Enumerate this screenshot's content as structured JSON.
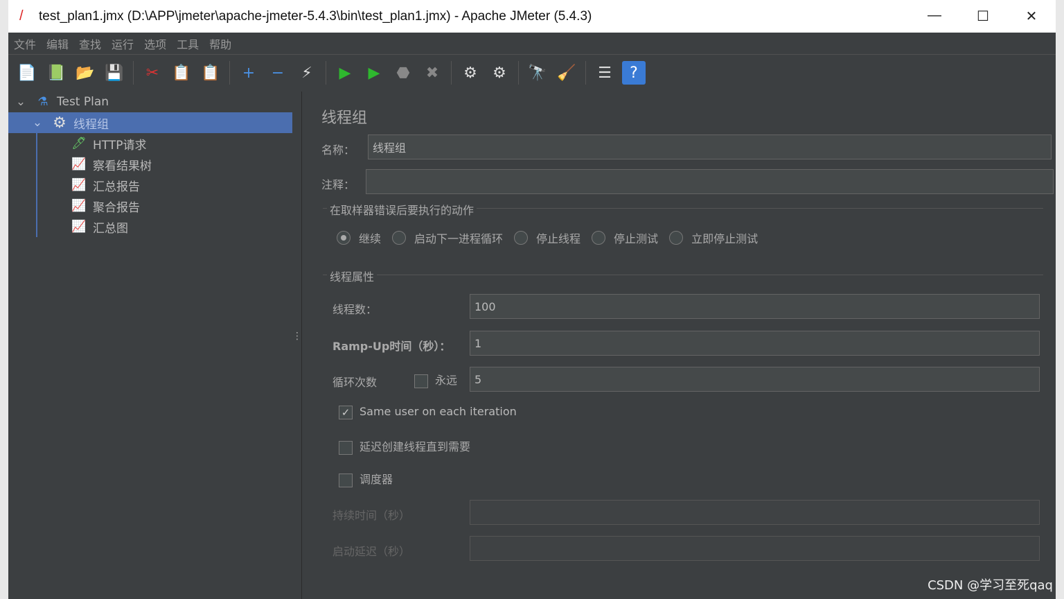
{
  "window": {
    "title": "test_plan1.jmx (D:\\APP\\jmeter\\apache-jmeter-5.4.3\\bin\\test_plan1.jmx) - Apache JMeter (5.4.3)",
    "minimize": "—",
    "maximize": "☐",
    "close": "✕"
  },
  "menu": [
    "文件",
    "编辑",
    "查找",
    "运行",
    "选项",
    "工具",
    "帮助"
  ],
  "toolbar": [
    {
      "name": "new-icon",
      "glyph": "📄"
    },
    {
      "name": "templates-icon",
      "glyph": "📗"
    },
    {
      "name": "open-icon",
      "glyph": "📂"
    },
    {
      "name": "save-icon",
      "glyph": "💾"
    },
    {
      "sep": true
    },
    {
      "name": "cut-icon",
      "glyph": "✂"
    },
    {
      "name": "copy-icon",
      "glyph": "📋"
    },
    {
      "name": "paste-icon",
      "glyph": "📋"
    },
    {
      "sep": true
    },
    {
      "name": "expand-icon",
      "glyph": "+"
    },
    {
      "name": "collapse-icon",
      "glyph": "−"
    },
    {
      "name": "toggle-icon",
      "glyph": "⚡"
    },
    {
      "sep": true
    },
    {
      "name": "start-icon",
      "glyph": "▶"
    },
    {
      "name": "start-no-pause-icon",
      "glyph": "▶"
    },
    {
      "name": "stop-icon",
      "glyph": "⬣"
    },
    {
      "name": "shutdown-icon",
      "glyph": "✖"
    },
    {
      "sep": true
    },
    {
      "name": "clear-icon",
      "glyph": "⚙"
    },
    {
      "name": "clear-all-icon",
      "glyph": "⚙"
    },
    {
      "sep": true
    },
    {
      "name": "search-icon",
      "glyph": "🔭"
    },
    {
      "name": "reset-search-icon",
      "glyph": "🧹"
    },
    {
      "sep": true
    },
    {
      "name": "function-helper-icon",
      "glyph": "☰"
    },
    {
      "name": "help-icon",
      "glyph": "?"
    }
  ],
  "tree": {
    "root": "Test Plan",
    "thread_group": "线程组",
    "children": [
      "HTTP请求",
      "察看结果树",
      "汇总报告",
      "聚合报告",
      "汇总图"
    ]
  },
  "panel": {
    "title": "线程组",
    "name_label": "名称：",
    "name_value": "线程组",
    "comment_label": "注释：",
    "comment_value": "",
    "error_section": "在取样器错误后要执行的动作",
    "error_options": [
      "继续",
      "启动下一进程循环",
      "停止线程",
      "停止测试",
      "立即停止测试"
    ],
    "error_selected": "继续",
    "props_section": "线程属性",
    "threads_label": "线程数：",
    "threads_value": "100",
    "rampup_label": "Ramp-Up时间（秒）：",
    "rampup_value": "1",
    "loop_label": "循环次数",
    "forever_label": "永远",
    "forever_checked": false,
    "loop_value": "5",
    "same_user_label": "Same user on each iteration",
    "same_user_checked": true,
    "delay_label": "延迟创建线程直到需要",
    "delay_checked": false,
    "scheduler_label": "调度器",
    "scheduler_checked": false,
    "duration_label": "持续时间（秒）",
    "duration_value": "",
    "startup_delay_label": "启动延迟（秒）",
    "startup_delay_value": ""
  },
  "watermark": "CSDN @学习至死qaq",
  "colors": {
    "bg": "#3c3f41",
    "selection": "#4b6eaf",
    "field": "#45494a"
  }
}
